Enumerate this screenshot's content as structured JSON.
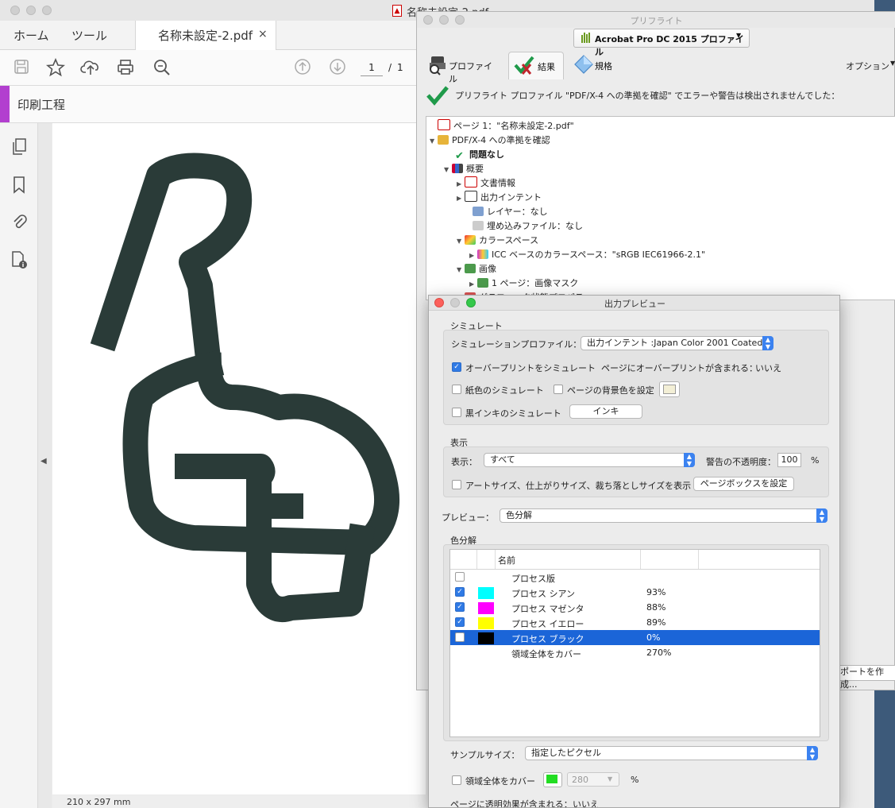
{
  "acrobat": {
    "window_title": "名称未設定-2.pdf",
    "tabs": {
      "home": "ホーム",
      "tools": "ツール",
      "document": "名称未設定-2.pdf",
      "close": "×"
    },
    "toolbar": {
      "page_current": "1",
      "page_sep": "/",
      "page_total": "1"
    },
    "tool_header": "印刷工程",
    "page_size": "210 x 297 mm"
  },
  "preflight": {
    "window_title": "プリフライト",
    "profile_select": "Acrobat Pro DC 2015 プロファイル",
    "tabs": {
      "profiles": "プロファイル",
      "results": "結果",
      "standards": "規格"
    },
    "options": "オプション",
    "result_message": "プリフライト プロファイル \"PDF/X-4 への準拠を確認\" でエラーや警告は検出されませんでした：",
    "tree": [
      {
        "label": "ページ 1：\"名称未設定-2.pdf\"",
        "icon": "pdf-icon"
      },
      {
        "label": "PDF/X-4 への準拠を確認",
        "icon": "preflight-icon"
      },
      {
        "label": "問題なし",
        "icon": "check-icon"
      },
      {
        "label": "概要",
        "icon": "overview-icon"
      },
      {
        "label": "文書情報",
        "icon": "doc-info-icon"
      },
      {
        "label": "出力インテント",
        "icon": "output-intent-icon"
      },
      {
        "label": "レイヤー：なし",
        "icon": "layers-icon"
      },
      {
        "label": "埋め込みファイル：なし",
        "icon": "attachment-icon"
      },
      {
        "label": "カラースペース",
        "icon": "colorspace-icon"
      },
      {
        "label": "ICC ベースのカラースペース：\"sRGB IEC61966-2.1\"",
        "icon": "icc-icon"
      },
      {
        "label": "画像",
        "icon": "image-icon"
      },
      {
        "label": "1 ページ：画像マスク",
        "icon": "image-icon"
      },
      {
        "label": "グラフィック状態プロパティ",
        "icon": "graphics-icon"
      }
    ],
    "report_button": "ポートを作成..."
  },
  "preview": {
    "window_title": "出力プレビュー",
    "simulate": {
      "header": "シミュレート",
      "profile_label": "シミュレーションプロファイル：",
      "profile_value": "出力インテント :Japan Color 2001 Coated",
      "overprint_label": "オーバープリントをシミュレート",
      "overprint_checked": true,
      "page_overprint_label": "ページにオーバープリントが含まれる：",
      "page_overprint_value": "いいえ",
      "paper_label": "紙色のシミュレート",
      "bg_label": "ページの背景色を設定",
      "bg_color": "#f3efd6",
      "black_ink_label": "黒インキのシミュレート",
      "ink_button": "インキ"
    },
    "display": {
      "header": "表示",
      "show_label": "表示：",
      "show_value": "すべて",
      "warn_label": "警告の不透明度：",
      "warn_value": "100",
      "percent": "%",
      "boxes_label": "アートサイズ、仕上がりサイズ、裁ち落としサイズを表示",
      "boxes_button": "ページボックスを設定"
    },
    "preview_label": "プレビュー：",
    "preview_value": "色分解",
    "separations": {
      "header": "色分解",
      "col_name": "名前",
      "rows": [
        {
          "name": "プロセス版",
          "checked": false,
          "color": "",
          "value": ""
        },
        {
          "name": "プロセス シアン",
          "checked": true,
          "color": "#00ffff",
          "value": "93%"
        },
        {
          "name": "プロセス マゼンタ",
          "checked": true,
          "color": "#ff00ff",
          "value": "88%"
        },
        {
          "name": "プロセス イエロー",
          "checked": true,
          "color": "#ffff00",
          "value": "89%"
        },
        {
          "name": "プロセス ブラック",
          "checked": false,
          "color": "#000000",
          "value": "0%",
          "selected": true
        },
        {
          "name": "領域全体をカバー",
          "checked": null,
          "color": "",
          "value": "270%"
        }
      ]
    },
    "sample_label": "サンプルサイズ：",
    "sample_value": "指定したピクセル",
    "coverage_label": "領域全体をカバー",
    "coverage_color": "#22dd22",
    "coverage_value": "280",
    "coverage_percent": "%",
    "transparency_label": "ページに透明効果が含まれる：",
    "transparency_value": "いいえ"
  }
}
